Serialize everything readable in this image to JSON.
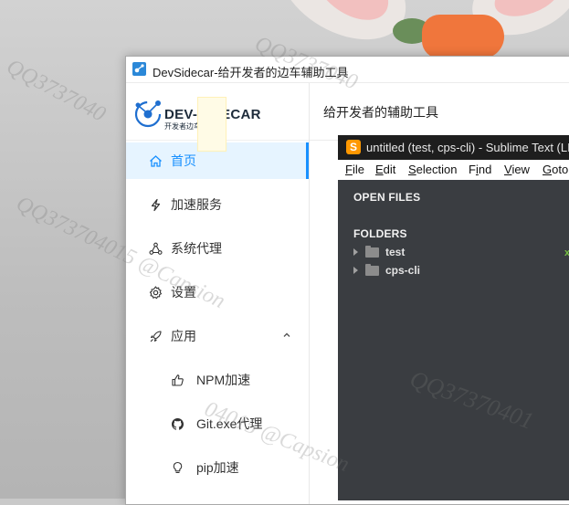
{
  "devsidecar": {
    "window_title": "DevSidecar-给开发者的边车辅助工具",
    "logo": {
      "text": "DEV-SIDECAR",
      "subtitle": "开发者边车"
    },
    "content_title": "给开发者的辅助工具",
    "accent_color": "#1890ff",
    "menu": [
      {
        "label": "首页",
        "icon": "home-icon",
        "active": true
      },
      {
        "label": "加速服务",
        "icon": "lightning-icon"
      },
      {
        "label": "系统代理",
        "icon": "share-nodes-icon"
      },
      {
        "label": "设置",
        "icon": "gear-icon"
      },
      {
        "label": "应用",
        "icon": "rocket-icon",
        "expanded": true
      },
      {
        "label": "NPM加速",
        "icon": "thumbs-up-icon"
      },
      {
        "label": "Git.exe代理",
        "icon": "github-icon"
      },
      {
        "label": "pip加速",
        "icon": "bulb-icon"
      }
    ]
  },
  "sublime": {
    "window_title": "untitled (test, cps-cli) - Sublime Text (LI",
    "menubar": [
      {
        "label": "File",
        "mnemonic": "F",
        "rest": "ile"
      },
      {
        "label": "Edit",
        "mnemonic": "E",
        "rest": "dit"
      },
      {
        "label": "Selection",
        "mnemonic": "S",
        "rest": "election"
      },
      {
        "label": "Find",
        "mnemonic": "i",
        "prefix": "F",
        "rest": "nd"
      },
      {
        "label": "View",
        "mnemonic": "V",
        "rest": "iew"
      },
      {
        "label": "Goto",
        "mnemonic": "G",
        "rest": "oto"
      }
    ],
    "open_files_heading": "OPEN FILES",
    "folders_heading": "FOLDERS",
    "folders": [
      "test",
      "cps-cli"
    ],
    "close_glyph": "x"
  },
  "watermark": {
    "text1": "QQ3737040",
    "text2": "QQ3737040",
    "text3": "QQ373704015 @Capsion",
    "text4": "QQ37370401",
    "text5": "04015 @Capsion"
  }
}
